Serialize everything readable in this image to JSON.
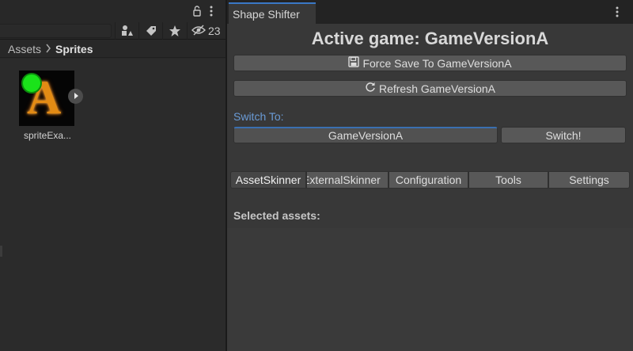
{
  "project": {
    "hidden_count": "23",
    "search": {
      "value": "",
      "placeholder": ""
    },
    "breadcrumb": [
      "Assets",
      "Sprites"
    ],
    "assets": [
      {
        "label": "spriteExa...",
        "thumb_letter": "A"
      }
    ]
  },
  "shape_shifter": {
    "window_tab": "Shape Shifter",
    "active_game_title": "Active game: GameVersionA",
    "force_save_label": "Force Save To GameVersionA",
    "refresh_label": "Refresh GameVersionA",
    "switch_to_label": "Switch To:",
    "selected_game": "GameVersionA",
    "switch_button": "Switch!",
    "tabs": [
      "AssetSkinner",
      "ExternalSkinner",
      "Configuration",
      "Tools",
      "Settings"
    ],
    "active_tab": "AssetSkinner",
    "selected_assets_label": "Selected assets:"
  },
  "colors": {
    "accent": "#3a78c6",
    "switch_label": "#6a9bd6",
    "status_dot": "#1ae31a",
    "sprite_letter": "#e38b14"
  },
  "icons": [
    "lock-icon",
    "kebab-menu-icon",
    "search-by-type-icon",
    "label-icon",
    "favorite-star-icon",
    "hidden-eye-icon",
    "play-icon",
    "floppy-save-icon",
    "refresh-icon"
  ]
}
